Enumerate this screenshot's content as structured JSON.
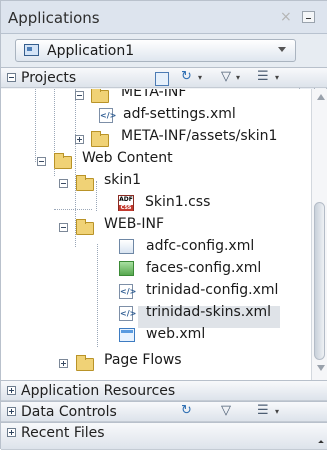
{
  "window": {
    "title": "Applications"
  },
  "application_selector": {
    "value": "Application1"
  },
  "projects_panel": {
    "title": "Projects"
  },
  "tree": {
    "items": [
      {
        "label": "META-INF"
      },
      {
        "label": "adf-settings.xml"
      },
      {
        "label": "META-INF/assets/skin1"
      },
      {
        "label": "Web Content"
      },
      {
        "label": "skin1"
      },
      {
        "label": "Skin1.css"
      },
      {
        "label": "WEB-INF"
      },
      {
        "label": "adfc-config.xml"
      },
      {
        "label": "faces-config.xml"
      },
      {
        "label": "trinidad-config.xml"
      },
      {
        "label": "trinidad-skins.xml"
      },
      {
        "label": "web.xml"
      },
      {
        "label": "Page Flows"
      }
    ]
  },
  "sections": {
    "application_resources": "Application Resources",
    "data_controls": "Data Controls",
    "recent_files": "Recent Files"
  },
  "icons": {
    "close": "×",
    "filter": "▽",
    "refresh": "↻",
    "menu": "☰"
  }
}
